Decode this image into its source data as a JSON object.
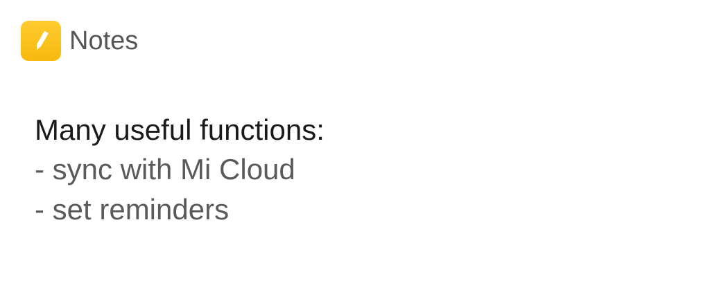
{
  "app": {
    "name": "Notes",
    "icon": "pencil-icon",
    "icon_color": "#fbc02d"
  },
  "notification": {
    "title": "Many useful functions:",
    "lines": [
      "- sync with Mi Cloud",
      "- set reminders"
    ]
  }
}
